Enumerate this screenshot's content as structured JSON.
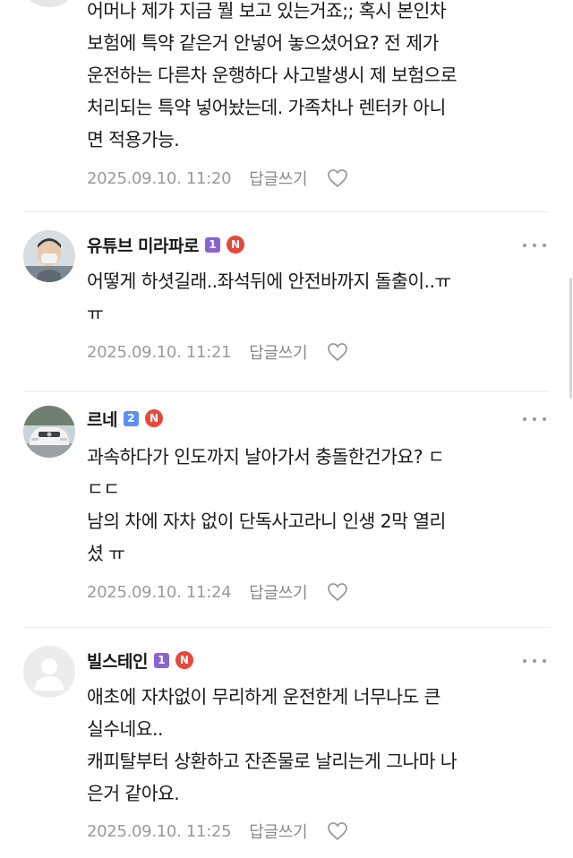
{
  "theme": {
    "level1_color": "#8a63d2",
    "level2_color": "#5b8ff0",
    "nbadge_color": "#e5493c"
  },
  "comments": [
    {
      "author": "",
      "lines": [
        "어머나 제가 지금 뭘 보고 있는거죠;; 혹시 본인차",
        "보험에 특약 같은거 안넣어 놓으셨어요? 전 제가",
        "운전하는 다른차 운행하다 사고발생시 제 보험으로",
        "처리되는 특약 넣어놨는데. 가족차나 렌터카 아니",
        "면 적용가능."
      ],
      "date": "2025.09.10. 11:20",
      "reply_label": "답글쓰기"
    },
    {
      "author": "유튜브 미라파로",
      "level": "1",
      "badge": "N",
      "lines": [
        "어떻게 하셧길래..좌석뒤에 안전바까지 돌출이..ㅠ",
        "ㅠ"
      ],
      "date": "2025.09.10. 11:21",
      "reply_label": "답글쓰기"
    },
    {
      "author": "르네",
      "level": "2",
      "badge": "N",
      "lines": [
        "과속하다가 인도까지 날아가서 충돌한건가요? ㄷ",
        "ㄷㄷ",
        "남의 차에 자차 없이 단독사고라니 인생 2막 열리",
        "셨 ㅠ"
      ],
      "date": "2025.09.10. 11:24",
      "reply_label": "답글쓰기"
    },
    {
      "author": "빌스테인",
      "level": "1",
      "badge": "N",
      "lines": [
        "애초에 자차없이 무리하게 운전한게 너무나도 큰",
        "실수네요..",
        "캐피탈부터 상환하고 잔존물로 날리는게 그나마 나",
        "은거 같아요."
      ],
      "date": "2025.09.10. 11:25",
      "reply_label": "답글쓰기"
    }
  ]
}
